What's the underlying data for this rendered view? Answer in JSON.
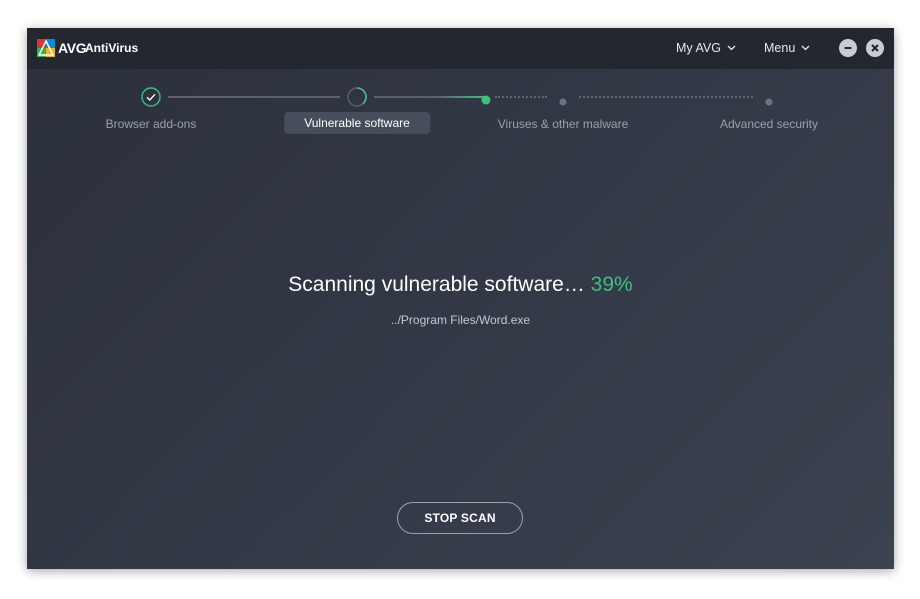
{
  "titlebar": {
    "brand": "AVG",
    "product": "AntiVirus",
    "my_avg_label": "My AVG",
    "menu_label": "Menu"
  },
  "steps": [
    {
      "label": "Browser add-ons",
      "state": "done"
    },
    {
      "label": "Vulnerable software",
      "state": "active"
    },
    {
      "label": "Viruses & other malware",
      "state": "pending"
    },
    {
      "label": "Advanced security",
      "state": "pending"
    }
  ],
  "scan": {
    "status_text": "Scanning vulnerable software…",
    "percent_text": "39%",
    "progress": 0.39,
    "current_file": "../Program Files/Word.exe",
    "stop_label": "STOP SCAN"
  },
  "colors": {
    "accent": "#3ec07e",
    "window_bg": "#333946",
    "titlebar_bg": "#23272f"
  }
}
